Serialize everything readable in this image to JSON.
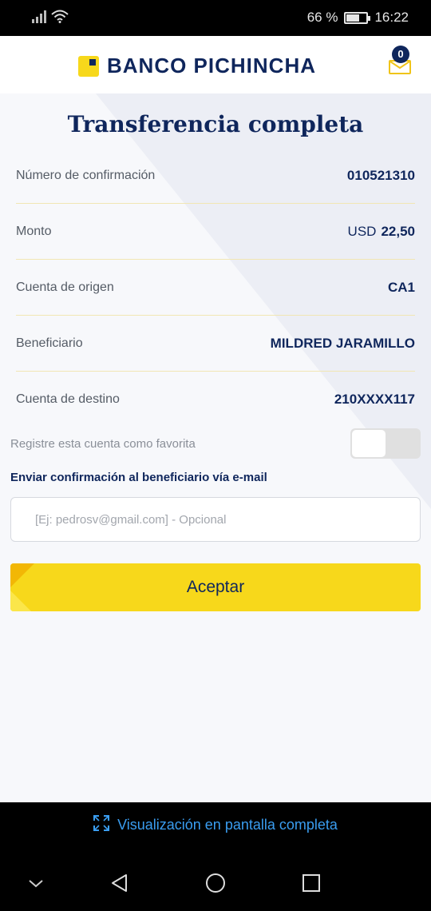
{
  "status_bar": {
    "battery_percent": "66 %",
    "battery_level": 0.66,
    "time": "16:22",
    "icons": [
      "signal-icon",
      "wifi-icon",
      "battery-icon"
    ]
  },
  "header": {
    "brand": "BANCO PICHINCHA",
    "mail_count": "0",
    "icons": [
      "bank-logo-icon",
      "mail-icon"
    ]
  },
  "main": {
    "title": "Transferencia completa",
    "details": [
      {
        "label": "Número de confirmación",
        "value": "010521310"
      },
      {
        "label": "Monto",
        "currency": "USD",
        "value": "22,50"
      },
      {
        "label": "Cuenta de origen",
        "value": "CA1"
      },
      {
        "label": "Beneficiario",
        "value": "MILDRED JARAMILLO"
      },
      {
        "label": "Cuenta de destino",
        "value": "210XXXX117"
      }
    ],
    "favorite_label": "Registre esta cuenta como favorita",
    "favorite_on": false,
    "email_label": "Enviar confirmación al beneficiario vía e-mail",
    "email_placeholder": "[Ej: pedrosv@gmail.com] - Opcional",
    "email_value": "",
    "accept_label": "Aceptar"
  },
  "bottom": {
    "fullscreen_label": "Visualización en pantalla completa",
    "icons": [
      "expand-icon",
      "chevron-down-icon",
      "back-icon",
      "home-icon",
      "recents-icon"
    ]
  },
  "colors": {
    "brand_navy": "#0f265c",
    "brand_yellow": "#f7d81b",
    "link_blue": "#3a9df0"
  }
}
